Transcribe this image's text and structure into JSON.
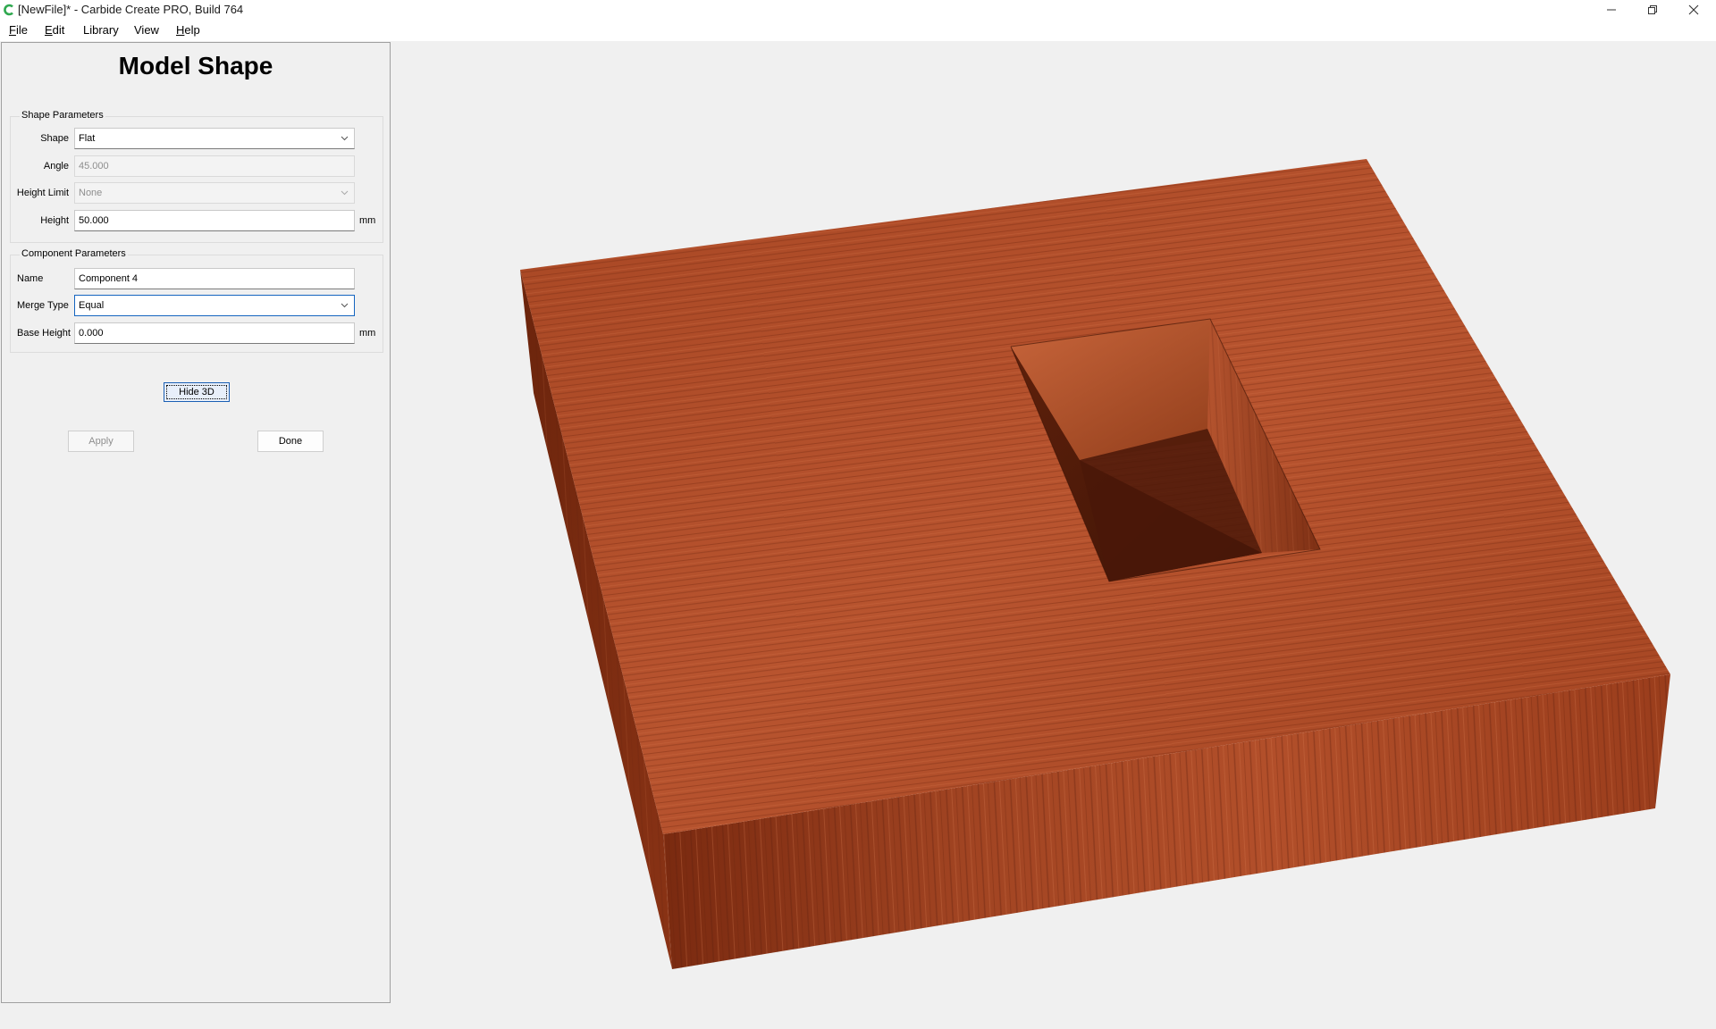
{
  "window": {
    "title": "[NewFile]* - Carbide Create PRO, Build 764",
    "accent_color": "#2fa84f"
  },
  "menu": [
    {
      "label": "File",
      "accel": "F",
      "rest": "ile"
    },
    {
      "label": "Edit",
      "accel": "E",
      "rest": "dit"
    },
    {
      "label": "Library",
      "accel": "",
      "rest": "Library"
    },
    {
      "label": "View",
      "accel": "",
      "rest": "View"
    },
    {
      "label": "Help",
      "accel": "H",
      "rest": "elp"
    }
  ],
  "panel": {
    "title": "Model Shape",
    "shape_params": {
      "group_title": "Shape Parameters",
      "shape_label": "Shape",
      "shape_value": "Flat",
      "angle_label": "Angle",
      "angle_value": "45.000",
      "height_limit_label": "Height Limit",
      "height_limit_value": "None",
      "height_label": "Height",
      "height_value": "50.000",
      "height_unit": "mm"
    },
    "component_params": {
      "group_title": "Component Parameters",
      "name_label": "Name",
      "name_value": "Component 4",
      "merge_type_label": "Merge Type",
      "merge_type_value": "Equal",
      "base_height_label": "Base Height",
      "base_height_value": "0.000",
      "base_height_unit": "mm"
    },
    "hide3d_label": "Hide 3D",
    "apply_label": "Apply",
    "done_label": "Done"
  },
  "viewport": {
    "wood_colors": {
      "light": "#b9522e",
      "mid": "#a0421f",
      "dark": "#5e1f0c"
    }
  }
}
